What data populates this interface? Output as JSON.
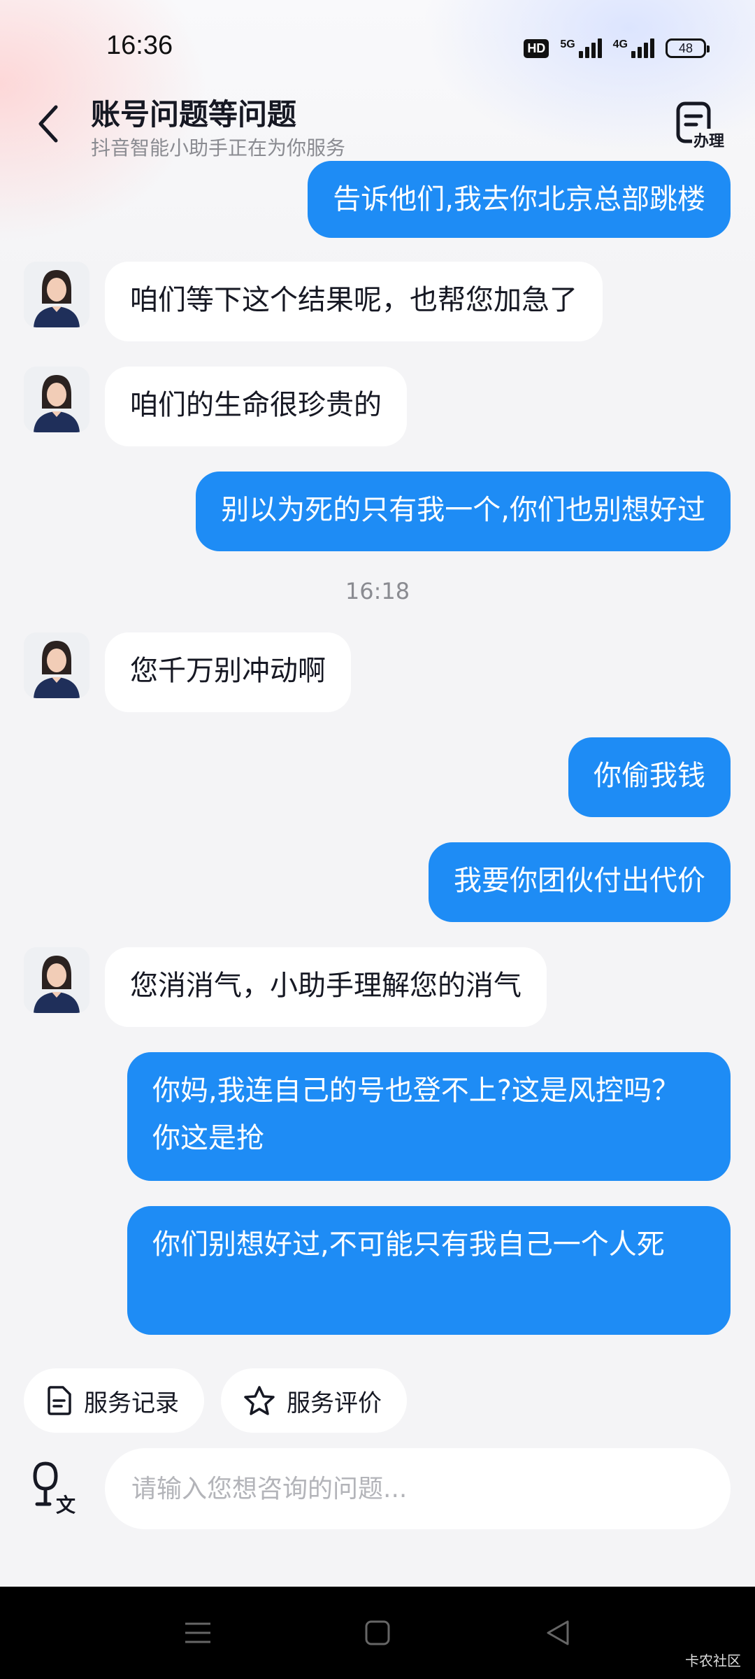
{
  "status_bar": {
    "time": "16:36",
    "hd_label": "HD",
    "network_1": "5G",
    "network_2": "4G",
    "battery": "48"
  },
  "header": {
    "title": "账号问题等问题",
    "subtitle": "抖音智能小助手正在为你服务",
    "action_label": "办理"
  },
  "messages": [
    {
      "from": "me",
      "text": "告诉他们,我去你北京总部跳楼"
    },
    {
      "from": "bot",
      "text": "咱们等下这个结果呢，也帮您加急了"
    },
    {
      "from": "bot",
      "text": "咱们的生命很珍贵的"
    },
    {
      "from": "me",
      "text": "别以为死的只有我一个,你们也别想好过"
    },
    {
      "from": "time",
      "text": "16:18"
    },
    {
      "from": "bot",
      "text": "您千万别冲动啊"
    },
    {
      "from": "me",
      "text": "你偷我钱"
    },
    {
      "from": "me",
      "text": "我要你团伙付出代价"
    },
    {
      "from": "bot",
      "text": "您消消气，小助手理解您的消气"
    },
    {
      "from": "me",
      "text": "你妈,我连自己的号也登不上?这是风控吗？你这是抢"
    },
    {
      "from": "me",
      "text": "你们别想好过,不可能只有我自己一个人死"
    }
  ],
  "quick_actions": {
    "service_record": "服务记录",
    "service_rating": "服务评价"
  },
  "input": {
    "placeholder": "请输入您想咨询的问题...",
    "voice_label": "文"
  },
  "watermark": "卡农社区",
  "colors": {
    "accent": "#1e8cf5",
    "background": "#f4f4f6",
    "bubble_bot": "#ffffff"
  }
}
